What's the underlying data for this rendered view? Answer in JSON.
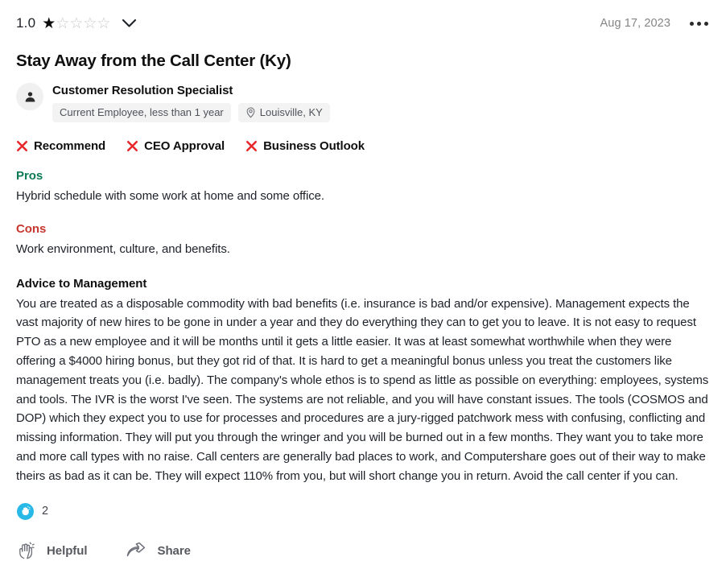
{
  "review": {
    "rating_value": "1.0",
    "rating_stars_filled": 1,
    "rating_stars_total": 5,
    "expand_icon": "chevron-down-icon",
    "date": "Aug 17, 2023",
    "overflow_icon": "three-dots-icon",
    "title": "Stay Away from the Call Center (Ky)",
    "author": {
      "avatar_icon": "person-icon",
      "job_title": "Customer Resolution Specialist",
      "employment_chip": "Current Employee, less than 1 year",
      "location_chip": "Louisville, KY",
      "location_icon": "map-pin-icon"
    },
    "flags": [
      {
        "label": "Recommend",
        "icon": "red-x-icon",
        "value": "negative"
      },
      {
        "label": "CEO Approval",
        "icon": "red-x-icon",
        "value": "negative"
      },
      {
        "label": "Business Outlook",
        "icon": "red-x-icon",
        "value": "negative"
      }
    ],
    "pros": {
      "heading": "Pros",
      "body": "Hybrid schedule with some work at home and some office."
    },
    "cons": {
      "heading": "Cons",
      "body": "Work environment, culture, and benefits."
    },
    "advice": {
      "heading": "Advice to Management",
      "body": "You are treated as a disposable commodity with bad benefits (i.e. insurance is bad and/or expensive). Management expects the vast majority of new hires to be gone in under a year and they do everything they can to get you to leave. It is not easy to request PTO as a new employee and it will be months until it gets a little easier. It was at least somewhat worthwhile when they were offering a $4000 hiring bonus, but they got rid of that. It is hard to get a meaningful bonus unless you treat the customers like management treats you (i.e. badly). The company's whole ethos is to spend as little as possible on everything: employees, systems and tools. The IVR is the worst I've seen. The systems are not reliable, and you will have constant issues. The tools (COSMOS and DOP) which they expect you to use for processes and procedures are a jury-rigged patchwork mess with confusing, conflicting and missing information. They will put you through the wringer and you will be burned out in a few months. They want you to take more and more call types with no raise. Call centers are generally bad places to work, and Computershare goes out of their way to make theirs as bad as it can be. They will expect 110% from you, but will short change you in return. Avoid the call center if you can."
    },
    "reactions": {
      "badge_icon": "clap-hands-icon",
      "count": "2"
    },
    "actions": [
      {
        "label": "Helpful",
        "icon": "clap-hands-icon"
      },
      {
        "label": "Share",
        "icon": "share-arrow-icon"
      }
    ]
  },
  "colors": {
    "pros_green": "#0b7a55",
    "cons_red": "#c7372f",
    "flag_x_red": "#e8282b",
    "reaction_blue": "#29b9e7",
    "text_primary": "#1d2129",
    "text_muted": "#858585",
    "chip_bg": "#f3f3f4"
  }
}
